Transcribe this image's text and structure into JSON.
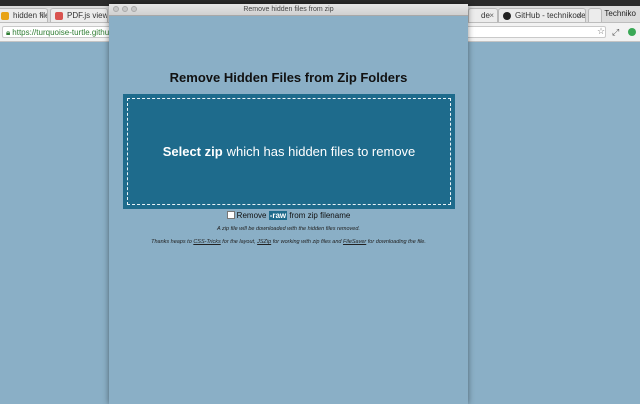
{
  "browser": {
    "tabs": [
      {
        "label": "hidden files f",
        "icon_color": "#e8a317"
      },
      {
        "label": "PDF.js viewer",
        "icon_color": "#d9534f"
      },
      {
        "label": "de",
        "icon_color": "#777777"
      },
      {
        "label": "GitHub - technikodev",
        "icon_color": "#222222"
      },
      {
        "label": "",
        "icon_color": "#bbbbbb"
      }
    ],
    "profile": "Techniko",
    "url": "https://turquoise-turtle.github.i"
  },
  "window": {
    "title": "Remove hidden files from zip"
  },
  "app": {
    "heading": "Remove Hidden Files from Zip Folders",
    "dropzone": {
      "strong": "Select zip",
      "rest": "which has hidden files to remove"
    },
    "option": {
      "before": "Remove",
      "highlight": "-raw",
      "after": "from zip filename",
      "checked": false
    },
    "note": "A zip file will be downloaded with the hidden files removed.",
    "thanks": {
      "p1": "Thanks heaps to",
      "link1": "CSS-Tricks",
      "p2": "for the layout,",
      "link2": "JSZip",
      "p3": "for working with zip files and",
      "link3": "FileSaver",
      "p4": "for downloading the file."
    }
  },
  "colors": {
    "background": "#8aafc6",
    "dropzone": "#1e6b8c"
  }
}
